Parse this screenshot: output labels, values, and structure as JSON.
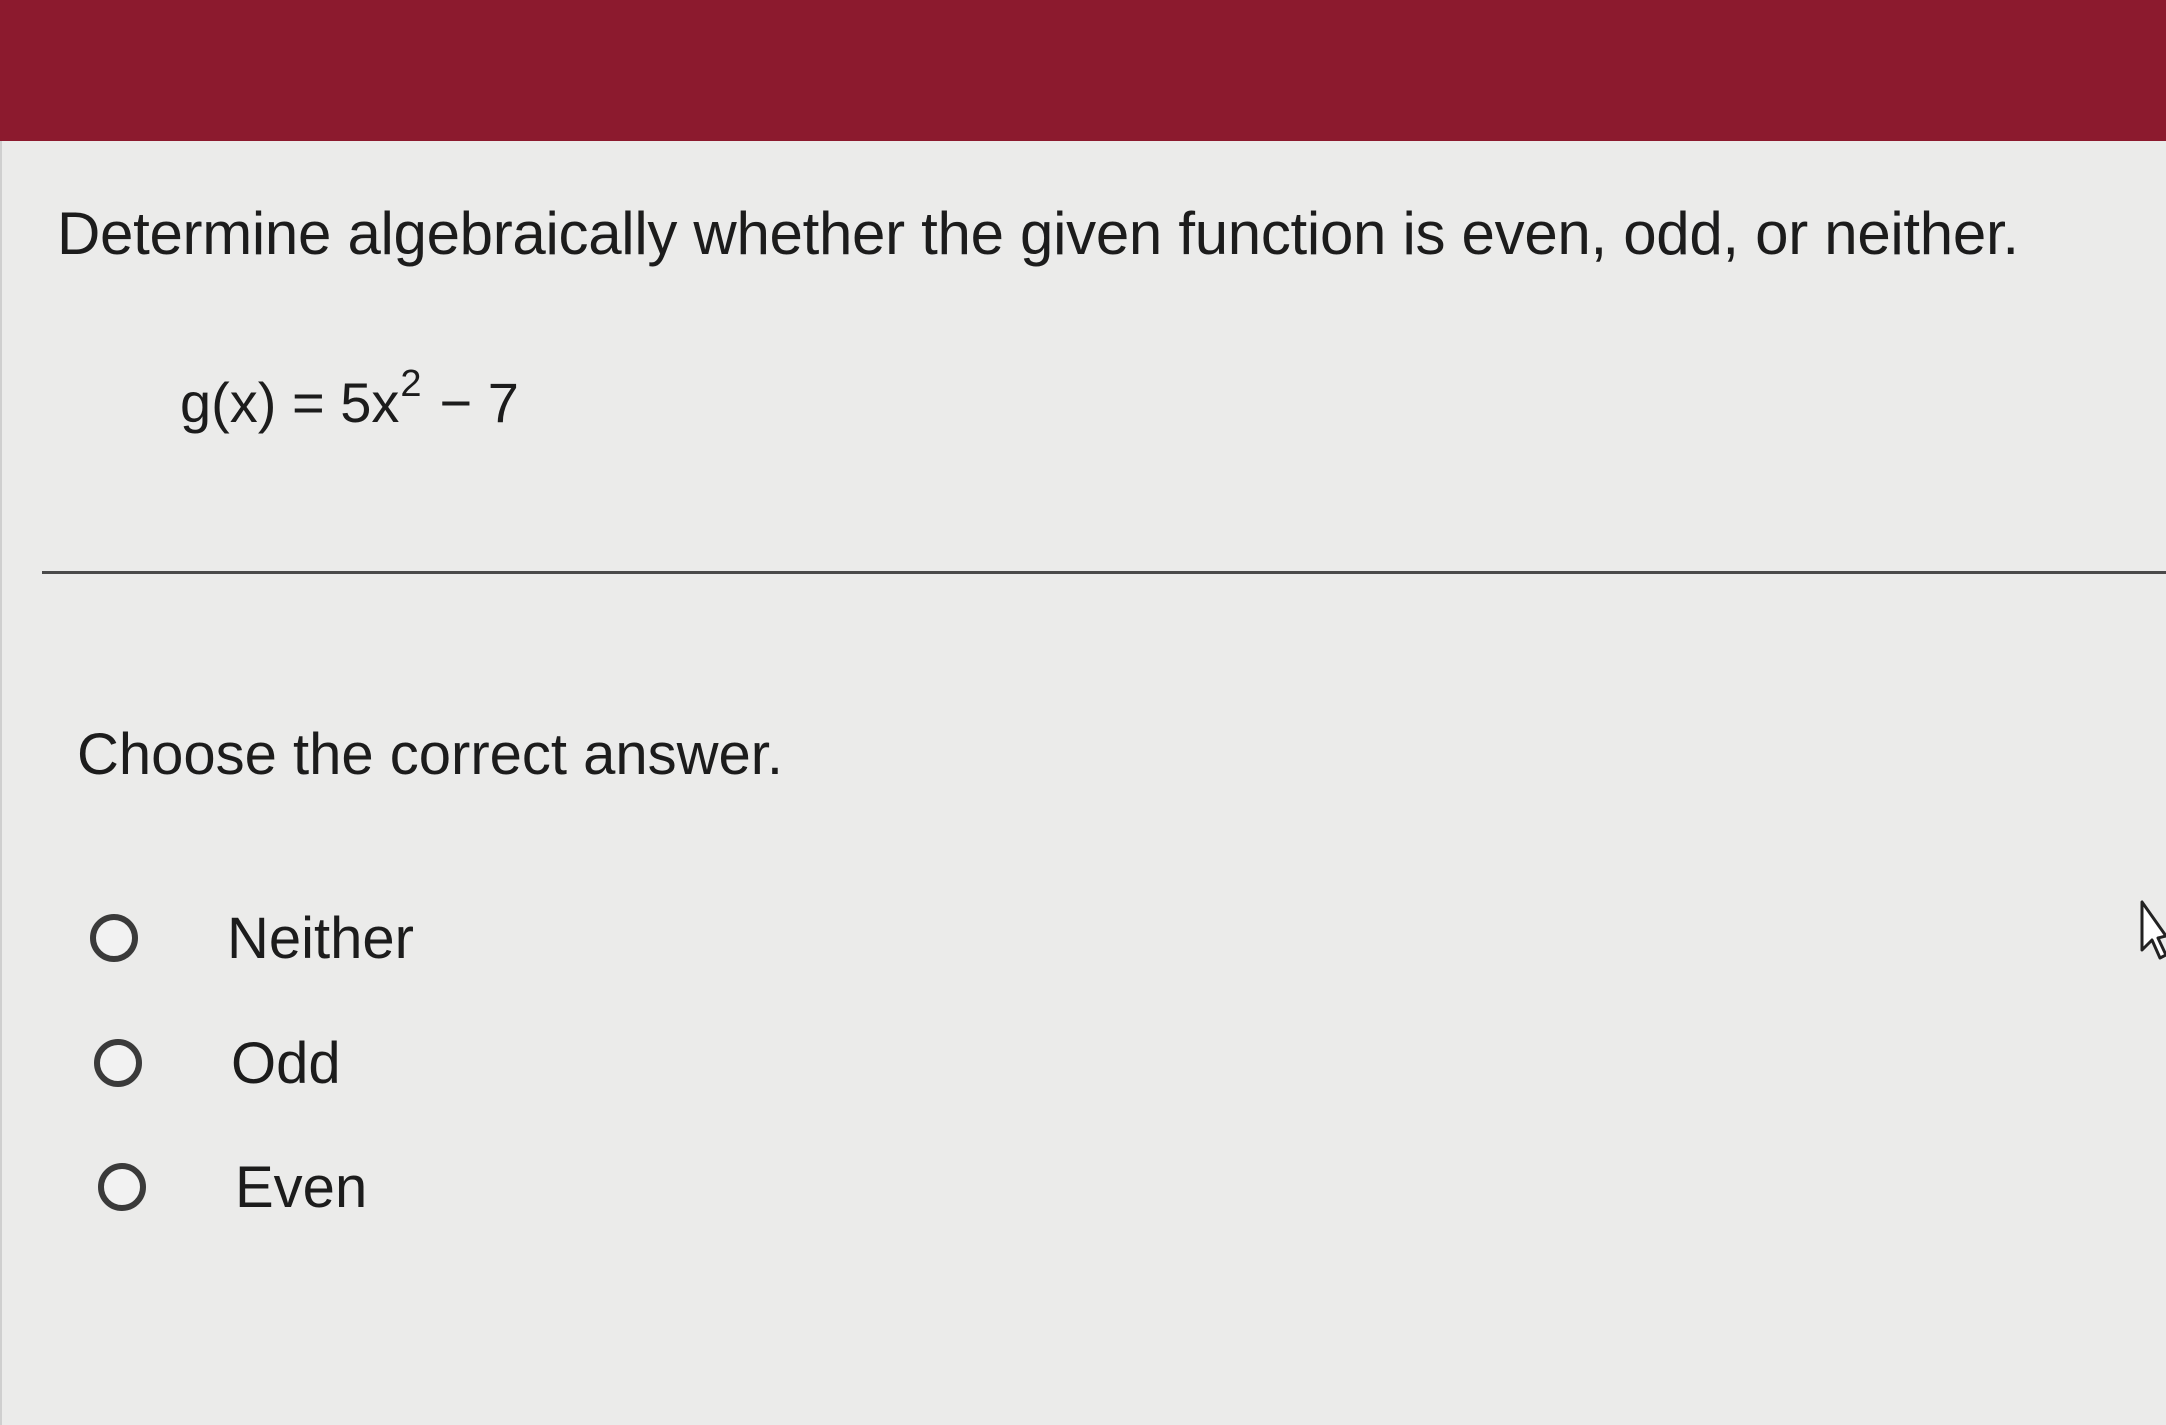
{
  "question": {
    "text": "Determine algebraically whether the given function is even, odd, or neither.",
    "equation_lhs": "g(x) = 5x",
    "equation_exponent": "2",
    "equation_rhs": "− 7"
  },
  "answer": {
    "prompt": "Choose the correct answer.",
    "options": [
      {
        "label": "Neither",
        "selected": false
      },
      {
        "label": "Odd",
        "selected": false
      },
      {
        "label": "Even",
        "selected": false
      }
    ]
  },
  "colors": {
    "header": "#8c1a2e",
    "background": "#ebebea",
    "text": "#1c1c1c"
  },
  "icons": {
    "radio": "radio-button-icon",
    "cursor": "mouse-cursor-icon"
  }
}
